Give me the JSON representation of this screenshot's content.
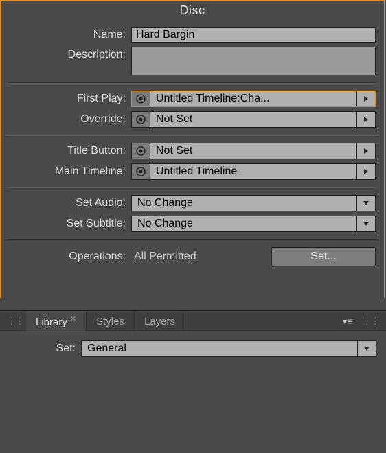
{
  "panel": {
    "title": "Disc",
    "name_label": "Name:",
    "name_value": "Hard Bargin",
    "description_label": "Description:",
    "first_play_label": "First Play:",
    "first_play_value": "Untitled Timeline:Cha...",
    "override_label": "Override:",
    "override_value": "Not Set",
    "title_button_label": "Title Button:",
    "title_button_value": "Not Set",
    "main_timeline_label": "Main Timeline:",
    "main_timeline_value": "Untitled Timeline",
    "set_audio_label": "Set Audio:",
    "set_audio_value": "No Change",
    "set_subtitle_label": "Set Subtitle:",
    "set_subtitle_value": "No Change",
    "operations_label": "Operations:",
    "operations_value": "All Permitted",
    "set_button_label": "Set...",
    "target_icon": "target-icon"
  },
  "tabs": {
    "active": "Library",
    "items": [
      "Library",
      "Styles",
      "Layers"
    ]
  },
  "bottom": {
    "set_label": "Set:",
    "set_value": "General"
  }
}
